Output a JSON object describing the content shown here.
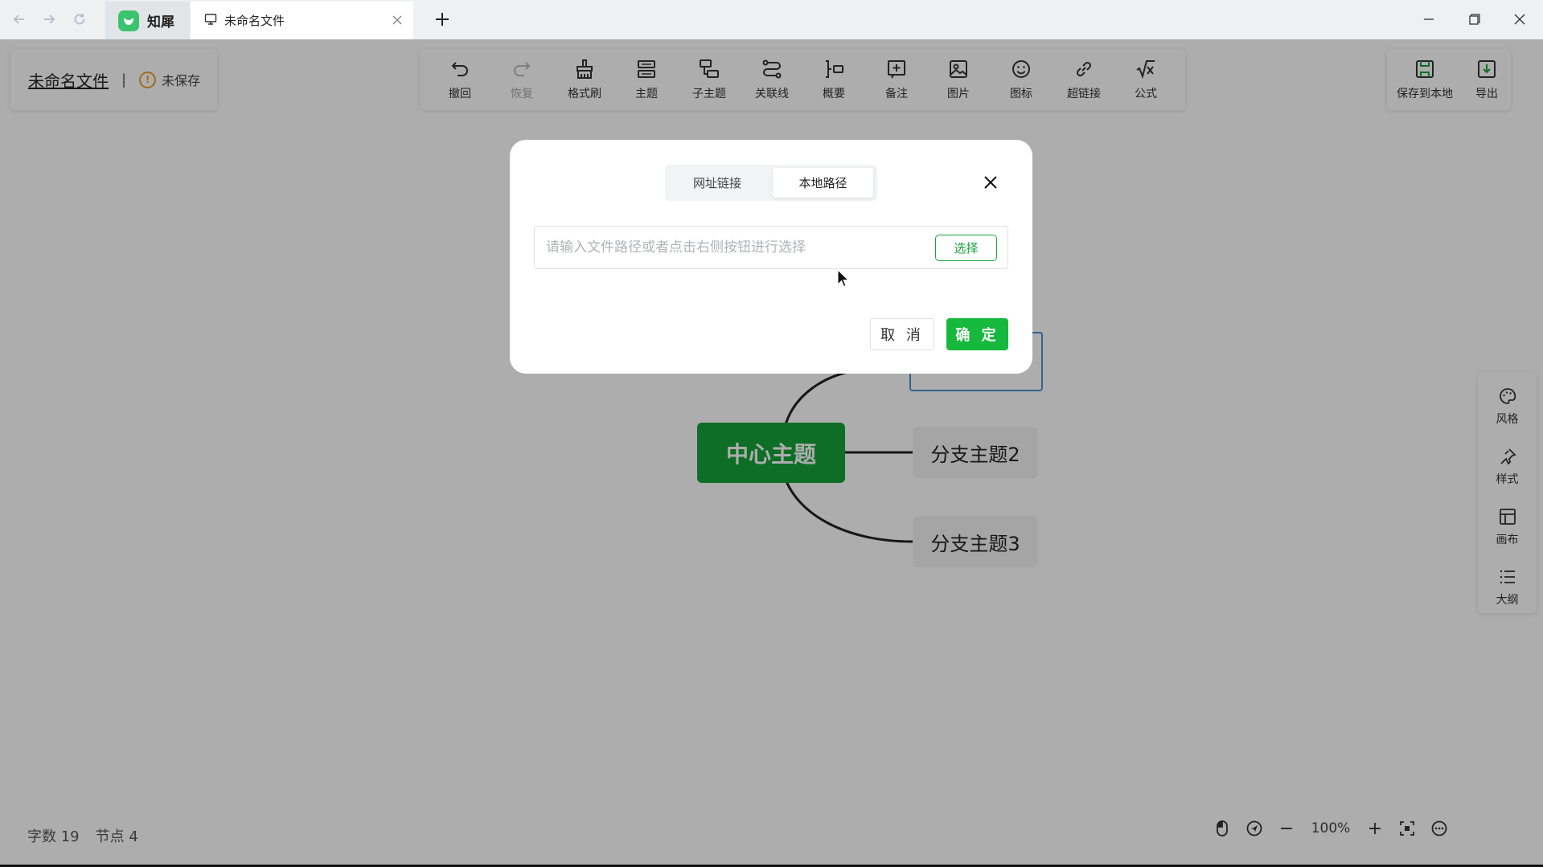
{
  "browser": {
    "app_tab_label": "知犀",
    "doc_tab_label": "未命名文件",
    "nav_back_icon": "arrow-left-icon",
    "nav_forward_icon": "arrow-right-icon",
    "nav_refresh_icon": "refresh-icon"
  },
  "header": {
    "file_name": "未命名文件",
    "separator": "|",
    "save_status": "未保存",
    "warn_mark": "!"
  },
  "toolbar": {
    "undo": "撤回",
    "redo": "恢复",
    "format_brush": "格式刷",
    "topic": "主题",
    "subtopic": "子主题",
    "relation": "关联线",
    "summary": "概要",
    "note": "备注",
    "image": "图片",
    "icon": "图标",
    "hyperlink": "超链接",
    "formula": "公式"
  },
  "save": {
    "save_local": "保存到本地",
    "export": "导出"
  },
  "side_panel": {
    "style_theme": "风格",
    "style": "样式",
    "canvas": "画布",
    "outline": "大纲"
  },
  "mindmap": {
    "center": "中心主题",
    "branch2": "分支主题2",
    "branch3": "分支主题3"
  },
  "status": {
    "word_count": "字数 19",
    "node_count": "节点 4"
  },
  "zoom": {
    "value": "100%",
    "minus": "−",
    "plus": "+"
  },
  "dialog": {
    "tab_url": "网址链接",
    "tab_local": "本地路径",
    "active_tab": "本地路径",
    "input_placeholder": "请输入文件路径或者点击右侧按钮进行选择",
    "input_value": "",
    "select_btn": "选择",
    "cancel": "取 消",
    "ok": "确 定"
  },
  "colors": {
    "accent": "#16a339",
    "ok_button": "#16b93d",
    "selection": "#4c8fd0"
  }
}
